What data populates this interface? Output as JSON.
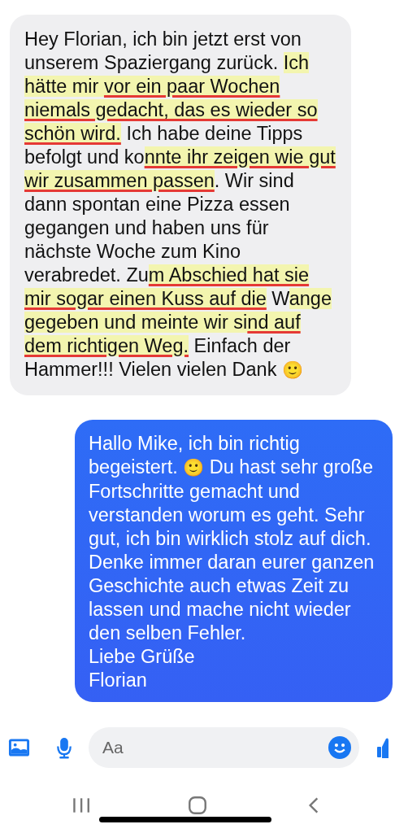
{
  "messages": [
    {
      "outgoing": false,
      "segments": [
        {
          "kind": "plain",
          "text": "Hey Florian, ich bin jetzt erst von unserem Spaziergang zurück. "
        },
        {
          "kind": "highlight",
          "text": "Ich hätte mir "
        },
        {
          "kind": "underline",
          "text": "vor ein paar Wochen niemals gedacht, das es wieder so schön wird."
        },
        {
          "kind": "plain",
          "text": " Ich habe deine Tipps befolgt und ko"
        },
        {
          "kind": "underline",
          "text": "nnte ihr zeigen wie gut wir zusammen passen"
        },
        {
          "kind": "plain",
          "text": ". Wir sind dann spontan eine Pizza essen gegangen und haben uns für nächste Woche zum Kino verabredet. Zu"
        },
        {
          "kind": "underline",
          "text": "m Abschied hat sie mir sogar einen Kuss auf die"
        },
        {
          "kind": "plain",
          "text": " W"
        },
        {
          "kind": "highlight",
          "text": "ange gegeben und meinte wir si"
        },
        {
          "kind": "underline",
          "text": "nd auf dem richtigen Weg."
        },
        {
          "kind": "plain",
          "text": " Einfach der Hammer!!! Vielen vielen Dank "
        },
        {
          "kind": "emoji",
          "text": "🙂"
        }
      ]
    },
    {
      "outgoing": true,
      "segments": [
        {
          "kind": "plain",
          "text": "Hallo Mike, ich bin richtig begeistert. "
        },
        {
          "kind": "emoji",
          "text": "🙂"
        },
        {
          "kind": "plain",
          "text": " Du hast sehr große Fortschritte gemacht und verstanden worum es geht. Sehr gut, ich bin wirklich stolz auf dich. Denke immer daran eurer ganzen Geschichte auch etwas Zeit zu lassen und mache nicht wieder den selben Fehler.\nLiebe Grüße\nFlorian"
        }
      ]
    }
  ],
  "composer": {
    "placeholder": "Aa"
  }
}
